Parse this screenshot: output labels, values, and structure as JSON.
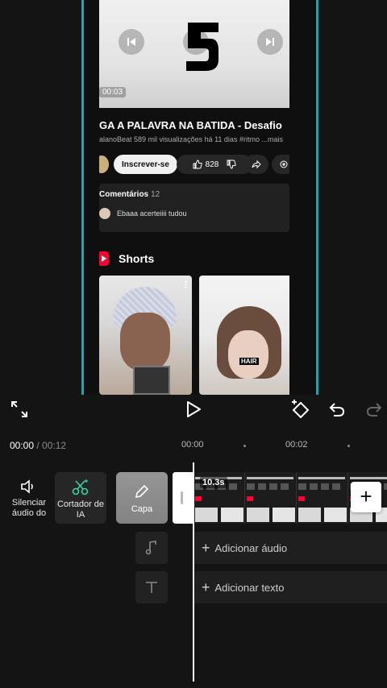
{
  "preview": {
    "video_time": "00:03",
    "video_title": "GA A PALAVRA NA BATIDA - Desafio",
    "video_meta": "alanoBeat  589 mil visualizações  há 11 dias  #ritmo ...mais",
    "subscribe_label": "Inscrever-se",
    "like_count": "828",
    "comments_label": "Comentários",
    "comments_count": "12",
    "comment_text": "Ebaaa acerteiiii tudou",
    "shorts_label": "Shorts",
    "short2_overlay": "HAIR"
  },
  "timeline": {
    "current_time": "00:00",
    "total_time": "00:12",
    "ruler_marks": [
      "00:00",
      "00:02"
    ],
    "clip_duration": "10.3s",
    "add_audio_label": "Adicionar áudio",
    "add_text_label": "Adicionar texto"
  },
  "tools": {
    "mute_label": "Silenciar áudio do",
    "ai_cutter_label": "Cortador de IA",
    "cover_label": "Capa"
  },
  "icons": {
    "fullscreen": "fullscreen-icon",
    "play": "play-icon",
    "keyframe": "keyframe-icon",
    "undo": "undo-icon",
    "redo": "redo-icon",
    "music": "music-note-icon",
    "text": "text-icon",
    "scissors": "ai-scissors-icon"
  },
  "colors": {
    "accent_teal": "#1aa7b5",
    "ai_green": "#3fd1a6",
    "youtube_red": "#ff0033"
  }
}
